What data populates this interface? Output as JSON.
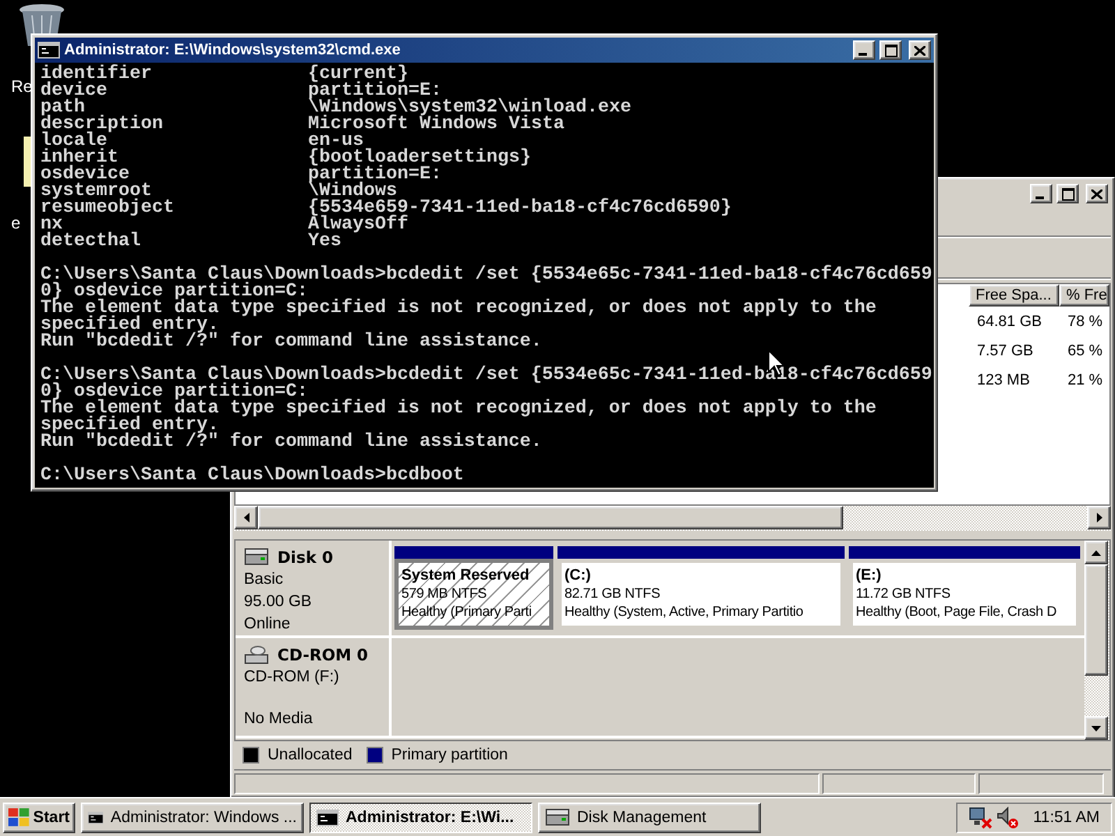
{
  "desktop": {
    "icons": [
      {
        "label": "Re",
        "kind": "bin"
      },
      {
        "label": "e",
        "kind": "note"
      }
    ]
  },
  "cmd_window": {
    "title": "Administrator: E:\\Windows\\system32\\cmd.exe",
    "entries": [
      {
        "name": "identifier",
        "value": "{current}"
      },
      {
        "name": "device",
        "value": "partition=E:"
      },
      {
        "name": "path",
        "value": "\\Windows\\system32\\winload.exe"
      },
      {
        "name": "description",
        "value": "Microsoft Windows Vista"
      },
      {
        "name": "locale",
        "value": "en-us"
      },
      {
        "name": "inherit",
        "value": "{bootloadersettings}"
      },
      {
        "name": "osdevice",
        "value": "partition=E:"
      },
      {
        "name": "systemroot",
        "value": "\\Windows"
      },
      {
        "name": "resumeobject",
        "value": "{5534e659-7341-11ed-ba18-cf4c76cd6590}"
      },
      {
        "name": "nx",
        "value": "AlwaysOff"
      },
      {
        "name": "detecthal",
        "value": "Yes"
      }
    ],
    "sessions": [
      {
        "lines": [
          "C:\\Users\\Santa Claus\\Downloads>bcdedit /set {5534e65c-7341-11ed-ba18-cf4c76cd659",
          "0} osdevice partition=C:",
          "The element data type specified is not recognized, or does not apply to the",
          "specified entry.",
          "Run \"bcdedit /?\" for command line assistance."
        ]
      },
      {
        "lines": [
          "C:\\Users\\Santa Claus\\Downloads>bcdedit /set {5534e65c-7341-11ed-ba18-cf4c76cd659",
          "0} osdevice partition=C:",
          "The element data type specified is not recognized, or does not apply to the",
          "specified entry.",
          "Run \"bcdedit /?\" for command line assistance."
        ]
      },
      {
        "lines": [
          "C:\\Users\\Santa Claus\\Downloads>bcdboot"
        ]
      }
    ]
  },
  "disk_management": {
    "volume_list": {
      "columns": [
        "Free Spa...",
        "% Fre"
      ],
      "rows": [
        [
          "64.81 GB",
          "78 %"
        ],
        [
          "7.57 GB",
          "65 %"
        ],
        [
          "123 MB",
          "21 %"
        ]
      ]
    },
    "disks": [
      {
        "kind": "disk",
        "name": "Disk 0",
        "type": "Basic",
        "size": "95.00 GB",
        "status": "Online",
        "partitions": [
          {
            "name": "System Reserved",
            "size": "579 MB NTFS",
            "status": "Healthy (Primary Parti",
            "selected": true
          },
          {
            "name": "(C:)",
            "size": "82.71 GB NTFS",
            "status": "Healthy (System, Active, Primary Partitio",
            "selected": false
          },
          {
            "name": "(E:)",
            "size": "11.72 GB NTFS",
            "status": "Healthy (Boot, Page File, Crash D",
            "selected": false
          }
        ]
      },
      {
        "kind": "cdrom",
        "name": "CD-ROM 0",
        "type": "CD-ROM (F:)",
        "status": "No Media"
      }
    ],
    "legend": [
      {
        "label": "Unallocated",
        "color": "#000000"
      },
      {
        "label": "Primary partition",
        "color": "#000080"
      }
    ]
  },
  "taskbar": {
    "start": "Start",
    "buttons": [
      {
        "label": "Administrator:  Windows ...",
        "kind": "cmd",
        "selected": false
      },
      {
        "label": "Administrator: E:\\Wi...",
        "kind": "cmd",
        "selected": true
      },
      {
        "label": "Disk Management",
        "kind": "disk",
        "selected": false
      }
    ],
    "clock": "11:51 AM"
  }
}
